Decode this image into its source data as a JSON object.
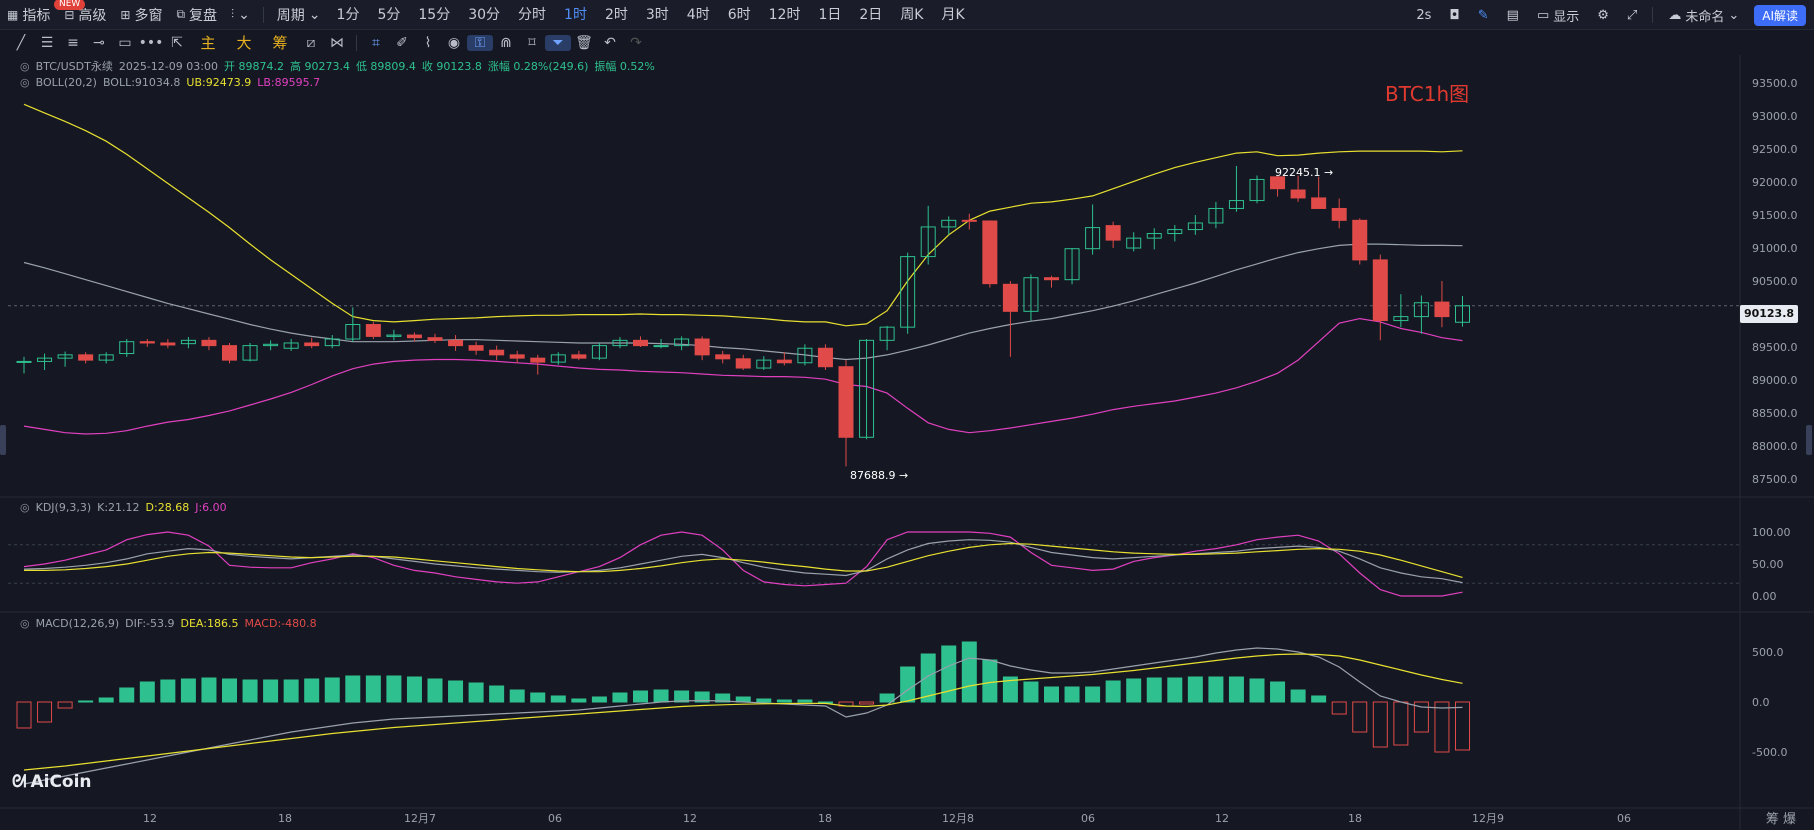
{
  "topbar": {
    "new_badge": "NEW",
    "items": [
      {
        "label": "指标",
        "icon": "indicator-icon"
      },
      {
        "label": "高级",
        "icon": "advanced-icon"
      },
      {
        "label": "多窗",
        "icon": "multi-window-icon"
      },
      {
        "label": "复盘",
        "icon": "replay-icon"
      }
    ],
    "period_label": "周期",
    "timeframes": [
      "1分",
      "5分",
      "15分",
      "30分",
      "分时",
      "1时",
      "2时",
      "3时",
      "4时",
      "6时",
      "12时",
      "1日",
      "2日",
      "周K",
      "月K"
    ],
    "active_timeframe": "1时",
    "refresh": "2s",
    "show_label": "显示",
    "layout_name": "未命名",
    "ai_label": "AI解读"
  },
  "toolbar": {
    "chips": [
      "主",
      "大",
      "筹"
    ]
  },
  "legend": {
    "pair": "BTC/USDT永续",
    "time": "2025-12-09 03:00",
    "open": "开 89874.2",
    "high": "高 90273.4",
    "low": "低 89809.4",
    "close": "收 90123.8",
    "change": "涨幅 0.28%(249.6)",
    "amp": "振幅 0.52%",
    "boll": "BOLL(20,2)",
    "boll_mid": "BOLL:91034.8",
    "boll_ub": "UB:92473.9",
    "boll_lb": "LB:89595.7",
    "kdj": "KDJ(9,3,3)",
    "kdj_k": "K:21.12",
    "kdj_d": "D:28.68",
    "kdj_j": "J:6.00",
    "macd": "MACD(12,26,9)",
    "macd_dif": "DIF:-53.9",
    "macd_dea": "DEA:186.5",
    "macd_val": "MACD:-480.8"
  },
  "annotation_title": "BTC1h图",
  "current_price": "90123.8",
  "high_label": "92245.1 →",
  "low_label": "87688.9 →",
  "watermark": "AiCoin",
  "bottom_right": "筹  爆",
  "colors": {
    "up": "#2ec08f",
    "down": "#e04a48",
    "boll_mid": "#9aa1ad",
    "boll_ub": "#e8e030",
    "boll_lb": "#e040c0",
    "k": "#9aa1ad",
    "d": "#e8e030",
    "j": "#e040c0"
  },
  "chart_data": {
    "type": "candlestick",
    "price_axis_ticks": [
      93500,
      93000,
      92500,
      92000,
      91500,
      91000,
      90500,
      90000,
      89500,
      89000,
      88500,
      88000,
      87500
    ],
    "kdj_axis_ticks": [
      100,
      50,
      0
    ],
    "macd_axis_ticks": [
      500,
      0,
      -500
    ],
    "x_tick_labels": [
      "12",
      "18",
      "12月7",
      "06",
      "12",
      "18",
      "12月8",
      "06",
      "12",
      "18",
      "12月9",
      "06"
    ],
    "candles": [
      [
        89280,
        89350,
        89100,
        89280
      ],
      [
        89280,
        89400,
        89150,
        89330
      ],
      [
        89330,
        89430,
        89200,
        89380
      ],
      [
        89380,
        89420,
        89250,
        89300
      ],
      [
        89300,
        89420,
        89250,
        89380
      ],
      [
        89400,
        89620,
        89350,
        89580
      ],
      [
        89580,
        89620,
        89500,
        89560
      ],
      [
        89560,
        89620,
        89480,
        89530
      ],
      [
        89550,
        89650,
        89480,
        89600
      ],
      [
        89600,
        89650,
        89450,
        89520
      ],
      [
        89520,
        89560,
        89250,
        89300
      ],
      [
        89300,
        89560,
        89280,
        89520
      ],
      [
        89520,
        89600,
        89450,
        89540
      ],
      [
        89480,
        89620,
        89440,
        89560
      ],
      [
        89560,
        89640,
        89480,
        89520
      ],
      [
        89520,
        89680,
        89480,
        89620
      ],
      [
        89620,
        90100,
        89580,
        89840
      ],
      [
        89840,
        89880,
        89620,
        89660
      ],
      [
        89660,
        89760,
        89600,
        89680
      ],
      [
        89680,
        89720,
        89580,
        89640
      ],
      [
        89640,
        89700,
        89560,
        89600
      ],
      [
        89600,
        89680,
        89440,
        89520
      ],
      [
        89520,
        89580,
        89380,
        89450
      ],
      [
        89450,
        89520,
        89300,
        89380
      ],
      [
        89380,
        89440,
        89250,
        89330
      ],
      [
        89330,
        89380,
        89080,
        89270
      ],
      [
        89270,
        89420,
        89230,
        89380
      ],
      [
        89380,
        89440,
        89300,
        89330
      ],
      [
        89330,
        89560,
        89300,
        89520
      ],
      [
        89520,
        89650,
        89480,
        89600
      ],
      [
        89600,
        89660,
        89500,
        89520
      ],
      [
        89520,
        89620,
        89480,
        89520
      ],
      [
        89520,
        89660,
        89450,
        89620
      ],
      [
        89620,
        89660,
        89300,
        89380
      ],
      [
        89380,
        89440,
        89250,
        89320
      ],
      [
        89320,
        89380,
        89150,
        89180
      ],
      [
        89180,
        89360,
        89150,
        89300
      ],
      [
        89300,
        89420,
        89220,
        89260
      ],
      [
        89260,
        89540,
        89220,
        89480
      ],
      [
        89480,
        89540,
        89150,
        89200
      ],
      [
        89200,
        89300,
        87689,
        88130
      ],
      [
        88130,
        89620,
        88100,
        89600
      ],
      [
        89600,
        89820,
        89450,
        89800
      ],
      [
        89800,
        90930,
        89700,
        90870
      ],
      [
        90870,
        91640,
        90750,
        91320
      ],
      [
        91320,
        91480,
        91200,
        91420
      ],
      [
        91420,
        91520,
        91280,
        91410
      ],
      [
        91410,
        91420,
        90400,
        90460
      ],
      [
        90450,
        90500,
        89350,
        90040
      ],
      [
        90040,
        90600,
        89900,
        90550
      ],
      [
        90550,
        90580,
        90400,
        90520
      ],
      [
        90520,
        91000,
        90450,
        90990
      ],
      [
        90990,
        91660,
        90900,
        91310
      ],
      [
        91340,
        91400,
        91000,
        91120
      ],
      [
        91000,
        91240,
        90950,
        91150
      ],
      [
        91150,
        91300,
        90980,
        91220
      ],
      [
        91220,
        91350,
        91100,
        91280
      ],
      [
        91280,
        91500,
        91200,
        91380
      ],
      [
        91380,
        91700,
        91300,
        91600
      ],
      [
        91600,
        92245,
        91550,
        91720
      ],
      [
        91720,
        92100,
        91680,
        92040
      ],
      [
        92080,
        92100,
        91780,
        91900
      ],
      [
        91880,
        92100,
        91700,
        91760
      ],
      [
        91760,
        92080,
        91600,
        91600
      ],
      [
        91600,
        91750,
        91300,
        91420
      ],
      [
        91420,
        91450,
        90750,
        90820
      ],
      [
        90820,
        90900,
        89600,
        89900
      ],
      [
        89900,
        90300,
        89800,
        89960
      ],
      [
        89960,
        90280,
        89700,
        90170
      ],
      [
        90180,
        90500,
        89800,
        89960
      ],
      [
        89874,
        90273,
        89809,
        90124
      ]
    ],
    "boll_ub": [
      93180,
      93050,
      92920,
      92780,
      92620,
      92420,
      92200,
      91980,
      91760,
      91540,
      91310,
      91060,
      90820,
      90600,
      90380,
      90160,
      89960,
      89900,
      89880,
      89900,
      89920,
      89930,
      89940,
      89960,
      89970,
      89980,
      89980,
      89990,
      89990,
      89990,
      90000,
      89990,
      89990,
      89980,
      89970,
      89950,
      89930,
      89900,
      89880,
      89880,
      89820,
      89850,
      90050,
      90500,
      90900,
      91200,
      91420,
      91560,
      91620,
      91680,
      91700,
      91740,
      91790,
      91900,
      92010,
      92120,
      92220,
      92300,
      92370,
      92440,
      92460,
      92400,
      92410,
      92440,
      92460,
      92470,
      92470,
      92470,
      92470,
      92460,
      92474
    ],
    "boll_mid": [
      90780,
      90700,
      90610,
      90520,
      90430,
      90340,
      90250,
      90160,
      90080,
      90000,
      89920,
      89840,
      89770,
      89710,
      89660,
      89620,
      89580,
      89580,
      89580,
      89590,
      89600,
      89610,
      89610,
      89600,
      89590,
      89580,
      89570,
      89560,
      89560,
      89560,
      89560,
      89550,
      89540,
      89520,
      89490,
      89470,
      89440,
      89410,
      89380,
      89340,
      89310,
      89330,
      89380,
      89450,
      89530,
      89620,
      89710,
      89780,
      89840,
      89890,
      89930,
      89990,
      90050,
      90120,
      90200,
      90290,
      90380,
      90470,
      90570,
      90670,
      90760,
      90850,
      90930,
      90990,
      91040,
      91060,
      91060,
      91050,
      91040,
      91040,
      91035
    ],
    "boll_lb": [
      88300,
      88250,
      88200,
      88180,
      88190,
      88230,
      88300,
      88360,
      88400,
      88460,
      88530,
      88620,
      88710,
      88810,
      88930,
      89060,
      89170,
      89240,
      89280,
      89300,
      89310,
      89310,
      89300,
      89280,
      89260,
      89240,
      89210,
      89180,
      89160,
      89150,
      89130,
      89120,
      89110,
      89090,
      89070,
      89060,
      89050,
      89050,
      89040,
      89010,
      88930,
      88900,
      88800,
      88570,
      88350,
      88250,
      88200,
      88230,
      88270,
      88320,
      88370,
      88420,
      88480,
      88550,
      88600,
      88640,
      88680,
      88740,
      88800,
      88880,
      88980,
      89100,
      89300,
      89580,
      89860,
      89930,
      89880,
      89780,
      89720,
      89640,
      89596
    ],
    "kdj_k": [
      42,
      43,
      45,
      48,
      52,
      58,
      66,
      70,
      74,
      72,
      65,
      62,
      60,
      58,
      60,
      62,
      64,
      62,
      58,
      54,
      50,
      47,
      44,
      42,
      40,
      38,
      37,
      38,
      40,
      44,
      50,
      56,
      62,
      65,
      60,
      52,
      45,
      40,
      36,
      34,
      32,
      40,
      58,
      72,
      82,
      86,
      88,
      87,
      84,
      76,
      68,
      64,
      60,
      58,
      60,
      62,
      64,
      66,
      68,
      70,
      74,
      76,
      78,
      76,
      70,
      58,
      44,
      36,
      30,
      27,
      21
    ],
    "kdj_d": [
      40,
      40,
      41,
      43,
      46,
      50,
      56,
      62,
      66,
      68,
      67,
      65,
      63,
      61,
      60,
      61,
      62,
      62,
      61,
      58,
      55,
      52,
      49,
      46,
      43,
      41,
      39,
      38,
      38,
      40,
      43,
      47,
      52,
      56,
      58,
      56,
      53,
      49,
      46,
      42,
      39,
      39,
      45,
      54,
      63,
      70,
      76,
      80,
      82,
      81,
      78,
      75,
      72,
      69,
      67,
      66,
      65,
      65,
      66,
      67,
      69,
      71,
      73,
      74,
      73,
      70,
      64,
      56,
      47,
      38,
      29
    ],
    "kdj_j": [
      46,
      50,
      56,
      64,
      72,
      88,
      96,
      100,
      95,
      78,
      48,
      45,
      44,
      44,
      52,
      58,
      66,
      60,
      48,
      40,
      36,
      30,
      26,
      22,
      20,
      22,
      30,
      38,
      46,
      60,
      80,
      95,
      100,
      95,
      72,
      40,
      22,
      18,
      16,
      18,
      20,
      46,
      88,
      100,
      100,
      100,
      100,
      98,
      92,
      68,
      48,
      44,
      40,
      42,
      54,
      60,
      64,
      70,
      74,
      80,
      88,
      92,
      95,
      86,
      66,
      36,
      10,
      0,
      0,
      0,
      6
    ],
    "macd_hist": [
      -260,
      -200,
      -60,
      10,
      40,
      140,
      200,
      220,
      230,
      240,
      230,
      220,
      220,
      220,
      230,
      240,
      260,
      260,
      260,
      250,
      230,
      210,
      190,
      160,
      120,
      90,
      60,
      30,
      50,
      90,
      110,
      120,
      110,
      100,
      80,
      50,
      30,
      20,
      20,
      0,
      -40,
      -20,
      80,
      350,
      480,
      560,
      600,
      420,
      250,
      200,
      150,
      150,
      150,
      210,
      230,
      240,
      240,
      250,
      250,
      250,
      230,
      200,
      120,
      60,
      -120,
      -300,
      -450,
      -430,
      -300,
      -500,
      -480
    ],
    "macd_dif": [
      -820,
      -780,
      -740,
      -700,
      -660,
      -620,
      -580,
      -540,
      -500,
      -460,
      -420,
      -380,
      -340,
      -300,
      -270,
      -240,
      -210,
      -190,
      -170,
      -160,
      -150,
      -140,
      -130,
      -120,
      -110,
      -100,
      -90,
      -80,
      -60,
      -40,
      -20,
      0,
      10,
      15,
      10,
      0,
      -10,
      -20,
      -30,
      -40,
      -150,
      -110,
      -30,
      120,
      260,
      360,
      440,
      420,
      360,
      320,
      290,
      290,
      300,
      330,
      360,
      390,
      420,
      450,
      490,
      520,
      540,
      530,
      500,
      450,
      350,
      200,
      60,
      0,
      -50,
      -60,
      -54
    ],
    "macd_dea": [
      -680,
      -660,
      -640,
      -615,
      -590,
      -565,
      -540,
      -515,
      -490,
      -465,
      -440,
      -415,
      -390,
      -365,
      -340,
      -315,
      -295,
      -275,
      -255,
      -240,
      -225,
      -210,
      -195,
      -180,
      -165,
      -150,
      -135,
      -120,
      -105,
      -90,
      -75,
      -60,
      -45,
      -35,
      -28,
      -22,
      -18,
      -15,
      -14,
      -14,
      -40,
      -45,
      -30,
      10,
      60,
      110,
      160,
      195,
      215,
      230,
      245,
      260,
      275,
      295,
      315,
      340,
      365,
      390,
      415,
      440,
      460,
      475,
      480,
      475,
      460,
      420,
      370,
      320,
      270,
      225,
      187
    ]
  }
}
